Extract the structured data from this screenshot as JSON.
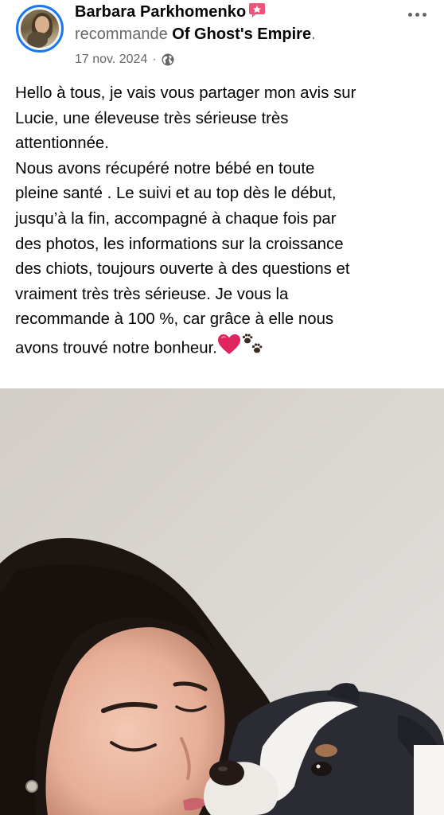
{
  "post": {
    "author": {
      "name": "Barbara Parkhomenko",
      "badge_icon": "recommend-badge-icon",
      "avatar_icon": "profile-avatar"
    },
    "recommend": {
      "verb": "recommande",
      "page_name": "Of Ghost's Empire",
      "suffix": "."
    },
    "date": "17 nov. 2024",
    "separator": "·",
    "audience_icon": "globe-icon",
    "more_icon": "more-options-icon",
    "body_text": "Hello à tous, je vais vous partager mon avis sur\nLucie, une éleveuse très sérieuse très\nattentionnée.\nNous avons récupéré notre bébé en toute\npleine santé . Le suivi et au top dès le début,\njusqu’à la fin, accompagné à chaque fois par\ndes photos, les informations sur la croissance\ndes chiots, toujours ouverte à des questions et\nvraiment très très sérieuse. Je vous la\nrecommande à 100 %, car grâce à elle nous\navons trouvé notre bonheur.",
    "body_emojis": [
      "heart-emoji",
      "paw-prints-emoji"
    ],
    "photo": {
      "subject": "woman-kissing-puppy-photo"
    }
  },
  "colors": {
    "text_primary": "#050505",
    "text_secondary": "#65676b",
    "avatar_ring": "#1877f2",
    "badge_pink": "#f0527a",
    "heart_red": "#e0245e",
    "photo_wall": "#d4cfcb"
  }
}
